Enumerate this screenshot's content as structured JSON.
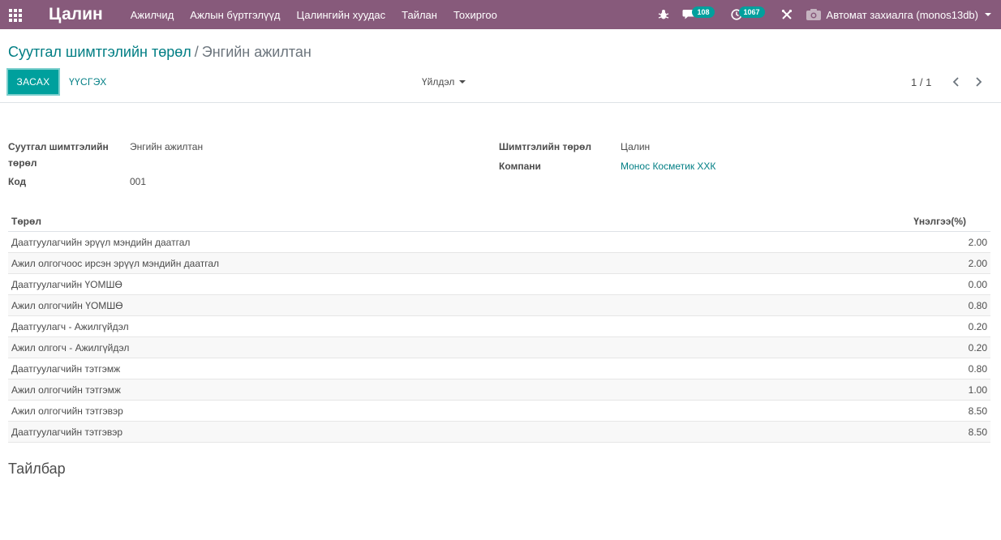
{
  "navbar": {
    "brand": "Цалин",
    "menu": [
      "Ажилчид",
      "Ажлын бүртгэлүүд",
      "Цалингийн хуудас",
      "Тайлан",
      "Тохиргоо"
    ],
    "messages_count": "108",
    "activities_count": "1067",
    "user": "Автомат захиалга (monos13db)"
  },
  "breadcrumb": {
    "parent": "Суутгал шимтгэлийн төрөл",
    "separator": "/",
    "current": "Энгийн ажилтан"
  },
  "buttons": {
    "edit": "ЗАСАХ",
    "create": "ҮҮСГЭХ",
    "action": "Үйлдэл"
  },
  "pager": "1 / 1",
  "form": {
    "type_label": "Суутгал шимтгэлийн төрөл",
    "type_value": "Энгийн ажилтан",
    "code_label": "Код",
    "code_value": "001",
    "contribution_label": "Шимтгэлийн төрөл",
    "contribution_value": "Цалин",
    "company_label": "Компани",
    "company_value": "Монос Косметик ХХК"
  },
  "table": {
    "headers": [
      "Төрөл",
      "Үнэлгээ(%)"
    ],
    "rows": [
      {
        "name": "Даатгуулагчийн эрүүл мэндийн даатгал",
        "rate": "2.00"
      },
      {
        "name": "Ажил олгогчоос ирсэн эрүүл мэндийн даатгал",
        "rate": "2.00"
      },
      {
        "name": "Даатгуулагчийн ҮОМШӨ",
        "rate": "0.00"
      },
      {
        "name": "Ажил олгогчийн ҮОМШӨ",
        "rate": "0.80"
      },
      {
        "name": "Даатгуулагч - Ажилгүйдэл",
        "rate": "0.20"
      },
      {
        "name": "Ажил олгогч - Ажилгүйдэл",
        "rate": "0.20"
      },
      {
        "name": "Даатгуулагчийн тэтгэмж",
        "rate": "0.80"
      },
      {
        "name": "Ажил олгогчийн тэтгэмж",
        "rate": "1.00"
      },
      {
        "name": "Ажил олгогчийн тэтгэвэр",
        "rate": "8.50"
      },
      {
        "name": "Даатгуулагчийн тэтгэвэр",
        "rate": "8.50"
      }
    ]
  },
  "notes_title": "Тайлбар",
  "colors": {
    "navbar": "#875a7b",
    "primary": "#00a09d",
    "link": "#017e84"
  }
}
